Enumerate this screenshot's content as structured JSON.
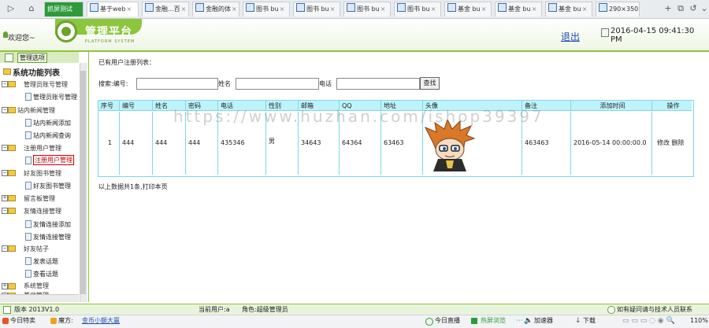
{
  "browser": {
    "tabs": [
      {
        "label": "抓屏测试",
        "active": false
      },
      {
        "label": "基于web",
        "active": true
      },
      {
        "label": "金融...百",
        "active": false
      },
      {
        "label": "金融的体",
        "active": false
      },
      {
        "label": "图书 bu",
        "active": false
      },
      {
        "label": "图书 bu",
        "active": false
      },
      {
        "label": "图书 bu",
        "active": false
      },
      {
        "label": "图书 bu",
        "active": false
      },
      {
        "label": "基金 bu",
        "active": false
      },
      {
        "label": "基金 bu",
        "active": false
      },
      {
        "label": "基金 bu",
        "active": false
      },
      {
        "label": "290×350",
        "active": false
      }
    ],
    "status": {
      "left1": "今日特卖",
      "left2": "魔方:",
      "left3": "金币小额大赢",
      "right1": "今日直播",
      "right2": "热屏浏览",
      "right3": "加速器",
      "right4": "下载",
      "zoom": "110%"
    }
  },
  "header": {
    "welcome": "欢迎您~",
    "title": "管理平台",
    "subtitle": "PLATFORM SYSTEM",
    "logout": "退出",
    "datetime": "2016-04-15 09:41:30 PM"
  },
  "sidebar": {
    "header_button": "管理选项",
    "title": "系统功能列表",
    "groups": [
      {
        "label": "管理员账号管理",
        "items": [
          "管理员账号管理"
        ]
      },
      {
        "label": "站内新闻管理",
        "items": [
          "站内新闻添加",
          "站内新闻查询"
        ]
      },
      {
        "label": "注册用户管理",
        "items": [
          "注册用户管理"
        ]
      },
      {
        "label": "好友图书管理",
        "items": [
          "好友图书管理"
        ]
      },
      {
        "label": "留言板管理",
        "items": []
      },
      {
        "label": "友情连接管理",
        "items": [
          "友情连接添加",
          "友情连接管理"
        ]
      },
      {
        "label": "好友帖子",
        "items": [
          "发表话题",
          "查看话题"
        ]
      },
      {
        "label": "系统管理",
        "items": []
      },
      {
        "label": "其他管理",
        "items": []
      }
    ]
  },
  "main": {
    "caption": "已有用户注册列表：",
    "search": {
      "label_id": "搜索:编号:",
      "label_name": "姓名",
      "label_phone": "电话",
      "button": "查找",
      "id_value": "",
      "name_value": "",
      "phone_value": ""
    },
    "table": {
      "headers": [
        "序号",
        "编号",
        "姓名",
        "密码",
        "电话",
        "性别",
        "邮箱",
        "QQ",
        "地址",
        "头像",
        "备注",
        "添加时间",
        "操作"
      ],
      "rows": [
        {
          "cells": [
            "1",
            "444",
            "444",
            "444",
            "435346",
            "男",
            "34643",
            "64364",
            "63463",
            "",
            "463463",
            "2016-05-14 00:00:00.0"
          ],
          "actions": [
            "修改",
            "删除"
          ]
        }
      ]
    },
    "footer": "以上数据共1条,打印本页",
    "watermark": "https://www.huzhan.com/ishop39397"
  },
  "app_footer": {
    "version": "版本 2013V1.0",
    "current_user": "当前用户:a",
    "role": "角色:超级管理员",
    "contact": "如有疑问请与技术人员联系"
  },
  "colors": {
    "accent": "#8cc63f",
    "table_border": "#7fd6e6",
    "table_header": "#bff3fb"
  }
}
